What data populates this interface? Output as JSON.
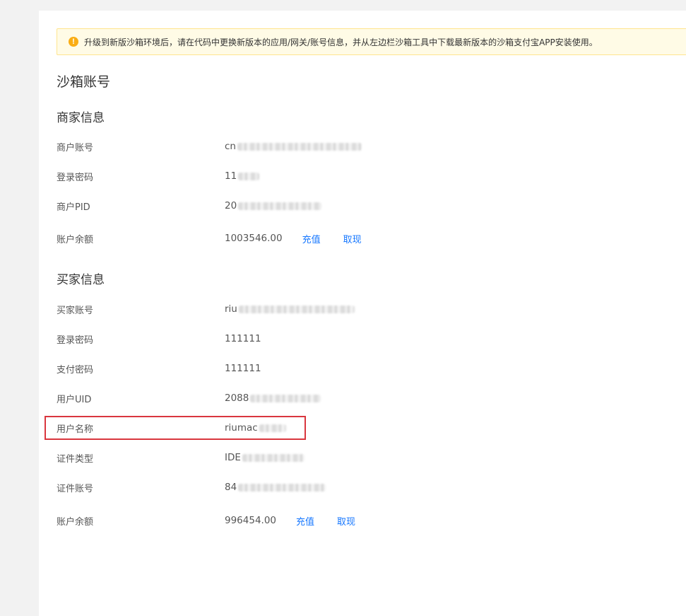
{
  "notice": {
    "text": "升级到新版沙箱环境后，请在代码中更换新版本的应用/网关/账号信息，并从左边栏沙箱工具中下载最新版本的沙箱支付宝APP安装使用。"
  },
  "page_title": "沙箱账号",
  "merchant": {
    "title": "商家信息",
    "account_label": "商户账号",
    "account_value": "cn",
    "password_label": "登录密码",
    "password_value": "11",
    "pid_label": "商户PID",
    "pid_value": "20",
    "balance_label": "账户余额",
    "balance_value": "1003546.00",
    "recharge_label": "充值",
    "withdraw_label": "取现"
  },
  "buyer": {
    "title": "买家信息",
    "account_label": "买家账号",
    "account_value": "riu",
    "login_password_label": "登录密码",
    "login_password_value": "111111",
    "pay_password_label": "支付密码",
    "pay_password_value": "111111",
    "uid_label": "用户UID",
    "uid_value": "2088",
    "username_label": "用户名称",
    "username_value": "riumac",
    "id_type_label": "证件类型",
    "id_type_value": "IDE",
    "id_number_label": "证件账号",
    "id_number_value": "84",
    "balance_label": "账户余额",
    "balance_value": "996454.00",
    "recharge_label": "充值",
    "withdraw_label": "取现"
  },
  "colors": {
    "link": "#1677ff",
    "notice_bg": "#fffbe6",
    "notice_border": "#ffe58f",
    "warning_icon": "#faad14",
    "highlight_border": "#d9363e"
  }
}
